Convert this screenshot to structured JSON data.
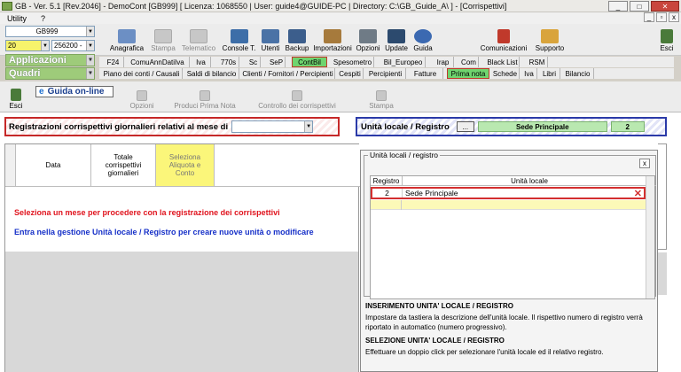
{
  "window": {
    "title": "GB - Ver. 5.1 [Rev.2046] - DemoCont [GB999]     [ Licenza: 1068550 | User: guide4@GUIDE-PC | Directory: C:\\GB_Guide_A\\ ] - [Corrispettivi]",
    "minimize": "_",
    "maximize": "□",
    "close": "✕"
  },
  "menu": {
    "items": [
      "Utility",
      "?"
    ]
  },
  "mdi": {
    "min": "_",
    "restore": "▫",
    "close": "x"
  },
  "left": {
    "company_code": "GB999",
    "year": "20",
    "user_code": "256200 -",
    "applicazioni": "Applicazioni",
    "quadri": "Quadri"
  },
  "toolbar": {
    "buttons": [
      {
        "label": "Anagrafica",
        "color": "#6c8fc4",
        "icon": "person-card-icon"
      },
      {
        "label": "Stampa",
        "color": "#9a9a9a",
        "icon": "printer-icon",
        "disabled": true
      },
      {
        "label": "Telematico",
        "color": "#9a9a9a",
        "icon": "network-icon",
        "disabled": true
      },
      {
        "label": "Console T.",
        "color": "#3d6ea8",
        "icon": "monitor-icon"
      },
      {
        "label": "Utenti",
        "color": "#4a72a6",
        "icon": "users-icon"
      },
      {
        "label": "Backup",
        "color": "#3c5e8c",
        "icon": "disk-icon"
      },
      {
        "label": "Importazioni",
        "color": "#a67a3c",
        "icon": "import-icon"
      },
      {
        "label": "Opzioni",
        "color": "#6f7b86",
        "icon": "options-icon"
      },
      {
        "label": "Update",
        "color": "#2c4a6e",
        "icon": "update-icon"
      },
      {
        "label": "Guida",
        "color": "#3b69b1",
        "icon": "help-icon"
      }
    ],
    "comunicazioni": "Comunicazioni",
    "supporto": "Supporto",
    "esci": "Esci"
  },
  "tabs_row1": [
    "F24",
    "ComuAnnDatiIva",
    "Iva",
    "770s",
    "Sc",
    "SeP",
    "ContBil",
    "Spesometro",
    "Bil_Europeo",
    "Irap",
    "Com",
    "Black List",
    "RSM"
  ],
  "tabs_row2": [
    "Piano dei conti / Causali",
    "Saldi di bilancio",
    "Clienti / Fornitori / Percipienti",
    "Cespiti",
    "Percipienti",
    "Fatture",
    "Prima nota",
    "Schede",
    "Iva",
    "Libri",
    "Bilancio"
  ],
  "subtoolbar": {
    "esci": "Esci",
    "guida_online": "Guida on-line",
    "opzioni": "Opzioni",
    "produci_prima_nota": "Produci Prima Nota",
    "controllo": "Controllo dei corrispettivi",
    "stampa": "Stampa"
  },
  "registrazioni": {
    "label": "Registrazioni corrispettivi giornalieri relativi al mese di",
    "month_value": ""
  },
  "unita": {
    "label": "Unità locale / Registro",
    "button": "...",
    "value": "Sede Principale",
    "number": "2"
  },
  "grid": {
    "col_data": "Data",
    "col_totale": "Totale corrispettivi giornalieri",
    "col_seleziona": "Seleziona Aliquota e Conto"
  },
  "messages": {
    "red": "Seleziona un mese per procedere con la registrazione dei corrispettivi",
    "blue": "Entra nella gestione Unità locale / Registro per creare nuove unità o modificare"
  },
  "popup": {
    "group_title": "Unità locali / registro",
    "close": "x",
    "col_registro": "Registro",
    "col_unita": "Unità locale",
    "rows": [
      {
        "registro": "2",
        "unita": "Sede Principale"
      }
    ],
    "delete": "✕",
    "help1_title": "INSERIMENTO UNITA' LOCALE / REGISTRO",
    "help1_text": "Impostare da tastiera la descrizione dell'unità locale. Il rispettivo numero di registro verrà riportato in automatico (numero progressivo).",
    "help2_title": "SELEZIONE UNITA' LOCALE / REGISTRO",
    "help2_text": "Effettuare un doppio click per selezionare l'unità locale ed il relativo registro."
  },
  "colors": {
    "accent_red": "#c62828",
    "accent_blue": "#2b3aa8",
    "message_red": "#e0141e",
    "message_blue": "#1630c8",
    "active_tab": "#6fd46f"
  }
}
